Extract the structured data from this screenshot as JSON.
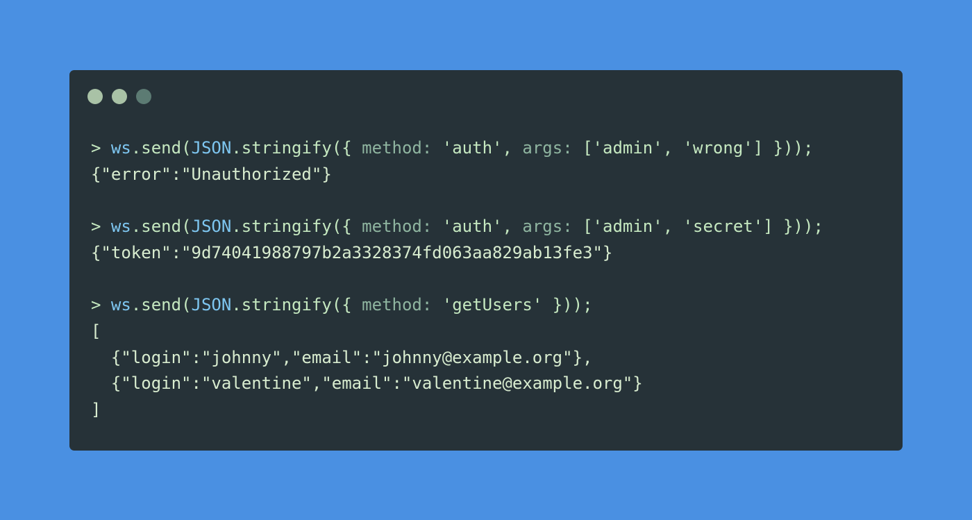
{
  "colors": {
    "background": "#4a90e2",
    "window": "#263238",
    "dot_1": "#a9c2a6",
    "dot_2": "#a9c2a6",
    "dot_3": "#5c7b73"
  },
  "terminal": {
    "lines": [
      {
        "kind": "command",
        "prompt": ">",
        "obj": "ws",
        "method": "send(",
        "json": "JSON",
        "fn": "stringify",
        "open": "({ ",
        "key1": "method:",
        "val1": "'auth'",
        "sep": ", ",
        "key2": "args:",
        "val2": "['admin', 'wrong']",
        "close": " }));"
      },
      {
        "kind": "output",
        "text": "{\"error\":\"Unauthorized\"}"
      },
      {
        "kind": "blank"
      },
      {
        "kind": "command",
        "prompt": ">",
        "obj": "ws",
        "method": "send(",
        "json": "JSON",
        "fn": "stringify",
        "open": "({ ",
        "key1": "method:",
        "val1": "'auth'",
        "sep": ", ",
        "key2": "args:",
        "val2": "['admin', 'secret']",
        "close": " }));"
      },
      {
        "kind": "output",
        "text": "{\"token\":\"9d74041988797b2a3328374fd063aa829ab13fe3\"}"
      },
      {
        "kind": "blank"
      },
      {
        "kind": "command",
        "prompt": ">",
        "obj": "ws",
        "method": "send(",
        "json": "JSON",
        "fn": "stringify",
        "open": "({ ",
        "key1": "method:",
        "val1": "'getUsers'",
        "sep": "",
        "key2": "",
        "val2": "",
        "close": " }));"
      },
      {
        "kind": "output",
        "text": "["
      },
      {
        "kind": "output",
        "text": "  {\"login\":\"johnny\",\"email\":\"johnny@example.org\"},"
      },
      {
        "kind": "output",
        "text": "  {\"login\":\"valentine\",\"email\":\"valentine@example.org\"}"
      },
      {
        "kind": "output",
        "text": "]"
      }
    ]
  }
}
